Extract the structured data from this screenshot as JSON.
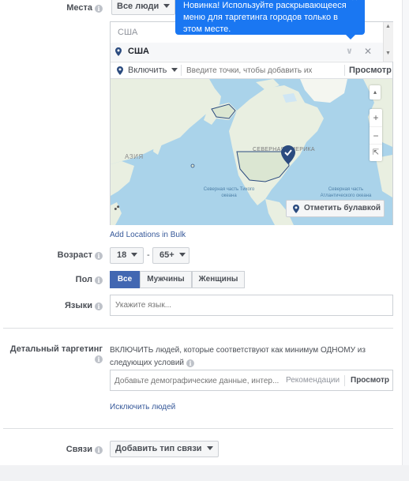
{
  "location": {
    "label": "Места",
    "people_dropdown": "Все люди",
    "country_header": "США",
    "selected_location": "США",
    "include_dropdown": "Включить",
    "search_placeholder": "Введите точки, чтобы добавить их",
    "browse_button": "Просмотр",
    "tooltip_text": "Новинка! Используйте раскрывающееся меню для таргетинга городов только в этом месте.",
    "map": {
      "labels": {
        "asia": "АЗИЯ",
        "north_america": "СЕВЕРНАЯ АМЕРИКА",
        "north_pacific": "Северная часть Тихого океана",
        "north_atlantic": "Северная часть Атлантического океана"
      },
      "drop_pin_button": "Отметить булавкой"
    },
    "bulk_link": "Add Locations in Bulk"
  },
  "age": {
    "label": "Возраст",
    "min": "18",
    "dash": "-",
    "max": "65+"
  },
  "gender": {
    "label": "Пол",
    "options": [
      "Все",
      "Мужчины",
      "Женщины"
    ],
    "selected": "Все"
  },
  "languages": {
    "label": "Языки",
    "placeholder": "Укажите язык..."
  },
  "detailed_targeting": {
    "label": "Детальный таргетинг",
    "description": "ВКЛЮЧИТЬ людей, которые соответствуют как минимум ОДНОМУ из следующих условий",
    "placeholder": "Добавьте демографические данные, интер...",
    "suggestions": "Рекомендации",
    "browse": "Просмотр",
    "exclude_link": "Исключить людей"
  },
  "connections": {
    "label": "Связи",
    "dropdown": "Добавить тип связи"
  },
  "colors": {
    "accent": "#4267b2",
    "link": "#365899",
    "tooltip": "#1a77f2",
    "pin": "#2b4b7f"
  }
}
